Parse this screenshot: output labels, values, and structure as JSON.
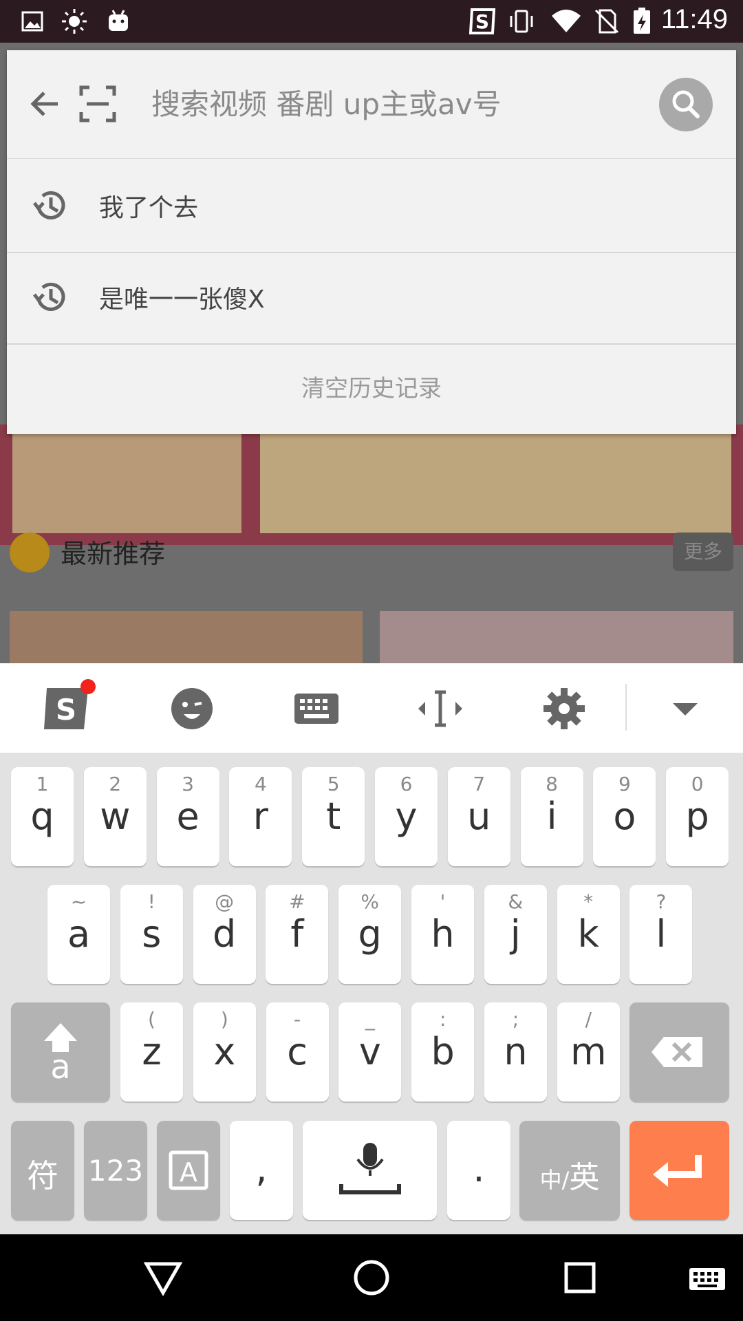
{
  "status_bar": {
    "time": "11:49",
    "icons": [
      "gallery-icon",
      "brightness-icon",
      "android-icon",
      "sogou-icon",
      "vibrate-icon",
      "wifi-icon",
      "no-sim-icon",
      "battery-charging-icon"
    ]
  },
  "background": {
    "section_title": "最新推荐",
    "more_label": "更多"
  },
  "search": {
    "placeholder": "搜索视频 番剧 up主或av号",
    "history": [
      {
        "label": "我了个去"
      },
      {
        "label": "是唯一一张傻X"
      }
    ],
    "clear_label": "清空历史记录"
  },
  "keyboard": {
    "toolbar": [
      "sogou-logo-icon",
      "emoji-icon",
      "keyboard-icon",
      "cursor-move-icon",
      "settings-icon",
      "collapse-icon"
    ],
    "row1": [
      {
        "sub": "1",
        "main": "q"
      },
      {
        "sub": "2",
        "main": "w"
      },
      {
        "sub": "3",
        "main": "e"
      },
      {
        "sub": "4",
        "main": "r"
      },
      {
        "sub": "5",
        "main": "t"
      },
      {
        "sub": "6",
        "main": "y"
      },
      {
        "sub": "7",
        "main": "u"
      },
      {
        "sub": "8",
        "main": "i"
      },
      {
        "sub": "9",
        "main": "o"
      },
      {
        "sub": "0",
        "main": "p"
      }
    ],
    "row2": [
      {
        "sub": "~",
        "main": "a"
      },
      {
        "sub": "!",
        "main": "s"
      },
      {
        "sub": "@",
        "main": "d"
      },
      {
        "sub": "#",
        "main": "f"
      },
      {
        "sub": "%",
        "main": "g"
      },
      {
        "sub": "'",
        "main": "h"
      },
      {
        "sub": "&",
        "main": "j"
      },
      {
        "sub": "*",
        "main": "k"
      },
      {
        "sub": "?",
        "main": "l"
      }
    ],
    "row3": [
      {
        "sub": "(",
        "main": "z"
      },
      {
        "sub": ")",
        "main": "x"
      },
      {
        "sub": "-",
        "main": "c"
      },
      {
        "sub": "_",
        "main": "v"
      },
      {
        "sub": ":",
        "main": "b"
      },
      {
        "sub": ";",
        "main": "n"
      },
      {
        "sub": "/",
        "main": "m"
      }
    ],
    "symbol_label": "符",
    "numbers_label": "123",
    "comma_label": ",",
    "period_label": ".",
    "lang_label_cn": "中/",
    "lang_label_en": "英"
  },
  "colors": {
    "enter_key": "#ff7e4e",
    "status_bar": "#2b1a20"
  },
  "nav_bar": {
    "icons": [
      "back-triangle-icon",
      "home-circle-icon",
      "recents-square-icon",
      "keyboard-switch-icon"
    ]
  }
}
